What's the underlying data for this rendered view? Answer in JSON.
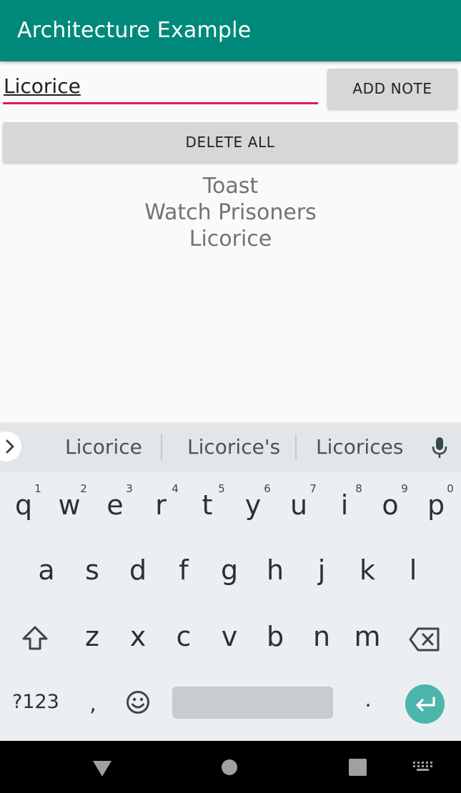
{
  "app": {
    "title": "Architecture Example"
  },
  "input": {
    "value": "Licorice"
  },
  "buttons": {
    "add_note": "ADD NOTE",
    "delete_all": "DELETE ALL"
  },
  "notes": [
    "Toast",
    "Watch Prisoners",
    "Licorice"
  ],
  "keyboard": {
    "suggestions": [
      "Licorice",
      "Licorice's",
      "Licorices"
    ],
    "row1": [
      "q",
      "w",
      "e",
      "r",
      "t",
      "y",
      "u",
      "i",
      "o",
      "p"
    ],
    "row1_hints": [
      "1",
      "2",
      "3",
      "4",
      "5",
      "6",
      "7",
      "8",
      "9",
      "0"
    ],
    "row2": [
      "a",
      "s",
      "d",
      "f",
      "g",
      "h",
      "j",
      "k",
      "l"
    ],
    "row3": [
      "z",
      "x",
      "c",
      "v",
      "b",
      "n",
      "m"
    ],
    "symbols_label": "?123",
    "comma": ",",
    "period": ".",
    "icons": {
      "expand": "chevron-right-icon",
      "mic": "mic-icon",
      "shift": "shift-icon",
      "backspace": "backspace-icon",
      "emoji": "emoji-icon",
      "enter": "enter-icon"
    }
  },
  "nav": {
    "icons": [
      "back-icon",
      "home-icon",
      "recents-icon",
      "keyboard-switch-icon"
    ]
  },
  "colors": {
    "app_bar": "#00897b",
    "input_underline": "#d81b60",
    "button": "#d6d7d7",
    "enter_key": "#4db6ac",
    "keyboard_bg": "#eceff1"
  }
}
